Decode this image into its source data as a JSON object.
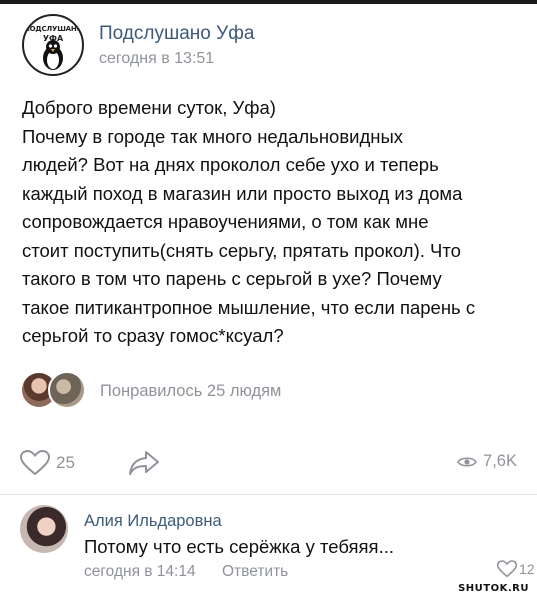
{
  "post": {
    "author": "Подслушано Уфа",
    "time": "сегодня в 13:51",
    "avatar_logo": {
      "line1": "ПОДСЛУШАНО",
      "line2": "УФА"
    },
    "text_lines": [
      "Доброго времени суток, Уфа)",
      "Почему в городе так много недальновидных",
      "людей? Вот на днях проколол себе ухо и теперь",
      "каждый поход в магазин или просто выход из дома",
      "сопровождается нравоучениями, о том как мне",
      "стоит поступить(снять серьгу, прятать прокол). Что",
      "такого в том что парень с серьгой в ухе? Почему",
      "такое питикантропное мышление, что если парень с",
      "серьгой то сразу гомос*ксуал?"
    ],
    "likes_text": "Понравилось 25 людям",
    "like_count": "25",
    "views": "7,6K",
    "icons": {
      "like": "heart-icon",
      "share": "share-arrow-icon",
      "views": "eye-icon"
    }
  },
  "comment": {
    "author": "Алия Ильдаровна",
    "text": "Потому что есть серёжка у тебяяя...",
    "time": "сегодня в 14:14",
    "reply_label": "Ответить",
    "like_count": "12"
  },
  "watermark": "SHUTOK.RU",
  "colors": {
    "accent": "#3d5a7a",
    "muted": "#8f9399",
    "divider": "#e7e8ec"
  }
}
